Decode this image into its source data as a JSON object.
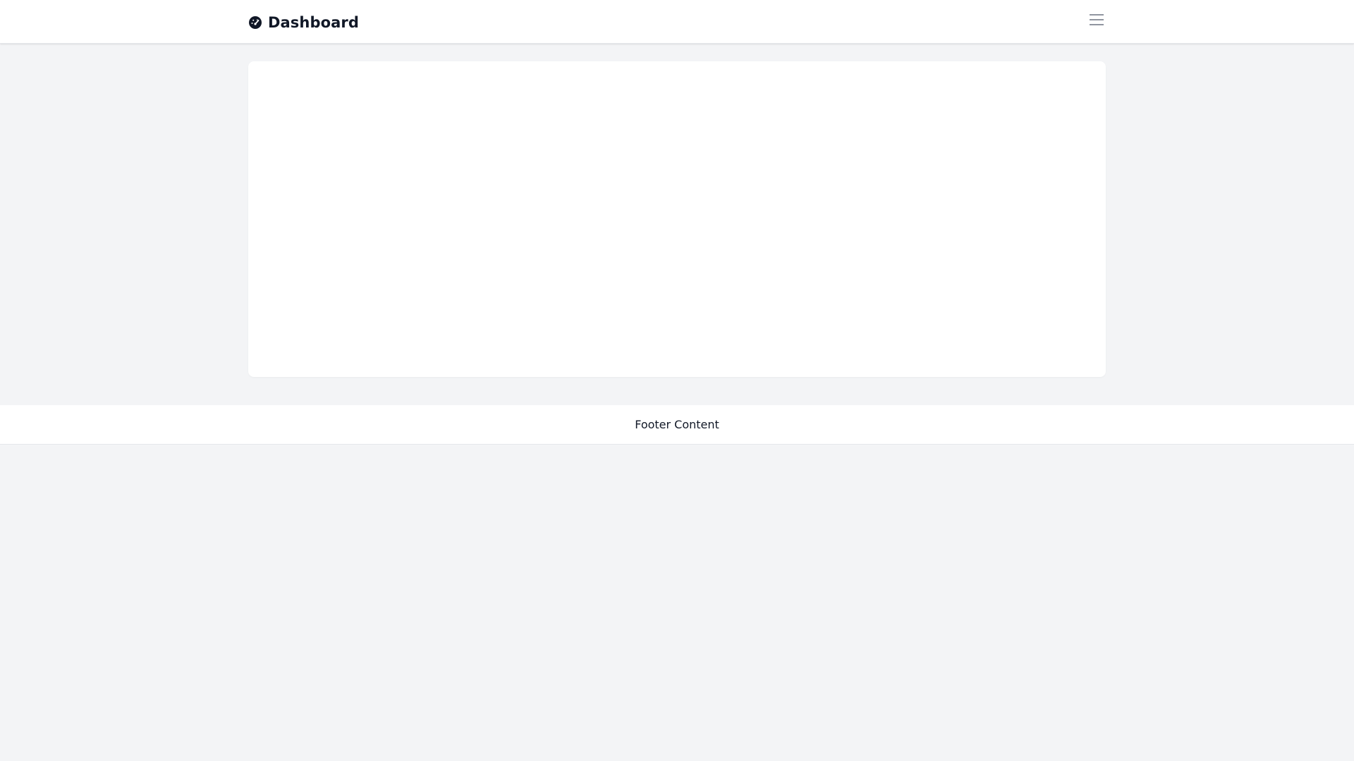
{
  "header": {
    "brand_title": "Dashboard",
    "brand_icon": "gauge-icon",
    "menu_icon": "hamburger-menu-icon"
  },
  "footer": {
    "text": "Footer Content"
  },
  "colors": {
    "page_background": "#f3f4f6",
    "surface": "#ffffff",
    "text_primary": "#111827",
    "icon_muted": "#6b7280"
  }
}
